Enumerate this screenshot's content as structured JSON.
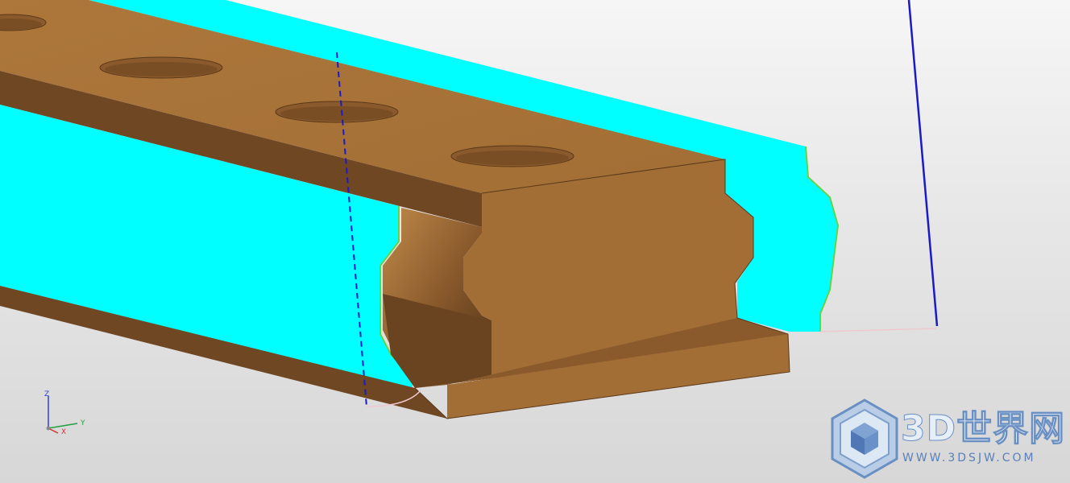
{
  "viewport": {
    "background_top": "#f6f6f6",
    "background_bottom": "#d7d7d7"
  },
  "model": {
    "part_color": "#a87339",
    "part_dark": "#6f4723",
    "part_mid": "#8a5a2c",
    "section_color": "#00ffff",
    "section_edge": "#6ad04a",
    "axis_color": "#1a1ac8"
  },
  "triad": {
    "z_label": "Z",
    "y_label": "Y",
    "x_label": "X",
    "z_color": "#3040d0",
    "y_color": "#20a040",
    "x_color": "#d03030"
  },
  "watermark": {
    "brand": "3D世界网",
    "url": "WWW.3DSJW.COM",
    "logo_icon": "cube-hexagon-logo",
    "color": "#6a8fc3"
  }
}
